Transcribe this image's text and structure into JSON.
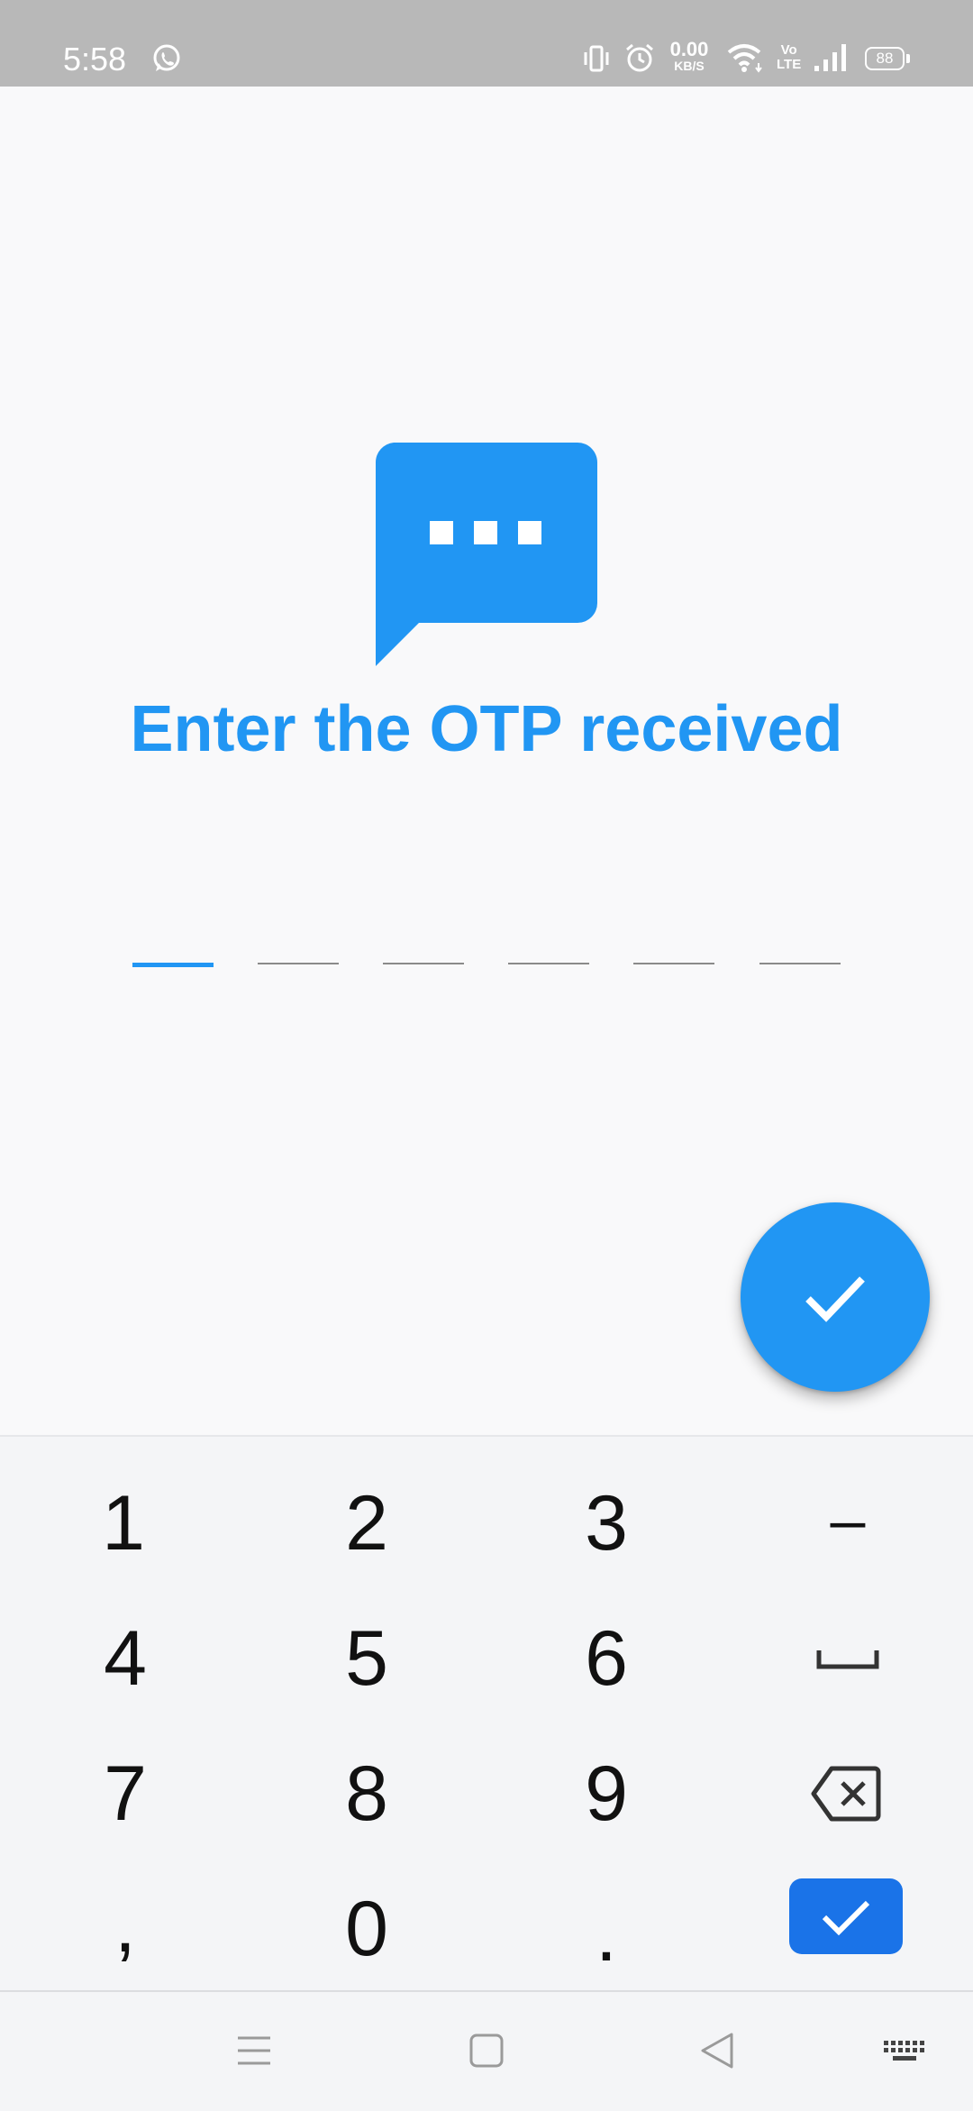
{
  "status_bar": {
    "time": "5:58",
    "net_speed_value": "0.00",
    "net_speed_unit": "KB/S",
    "volte_line1": "Vo",
    "volte_line2": "LTE",
    "battery_level": "88",
    "icons": [
      "whatsapp-icon",
      "vibrate-icon",
      "alarm-icon",
      "wifi-icon",
      "signal-icon",
      "battery-icon"
    ]
  },
  "main": {
    "icon": "sms-bubble-icon",
    "title": "Enter the OTP received",
    "otp_length": 6,
    "active_slot_index": 0,
    "fab_icon": "check-icon"
  },
  "keyboard": {
    "rows": [
      [
        "1",
        "2",
        "3",
        "–"
      ],
      [
        "4",
        "5",
        "6",
        "space-icon"
      ],
      [
        "7",
        "8",
        "9",
        "backspace-icon"
      ],
      [
        ",",
        "0",
        ".",
        "done-icon"
      ]
    ]
  },
  "nav_bar": {
    "icons": [
      "menu-icon",
      "home-icon",
      "back-icon",
      "keyboard-icon"
    ]
  },
  "colors": {
    "accent": "#2196f3",
    "done_key": "#1a73e8",
    "status_bar": "#b8b8b8",
    "background": "#f9f9fa"
  }
}
